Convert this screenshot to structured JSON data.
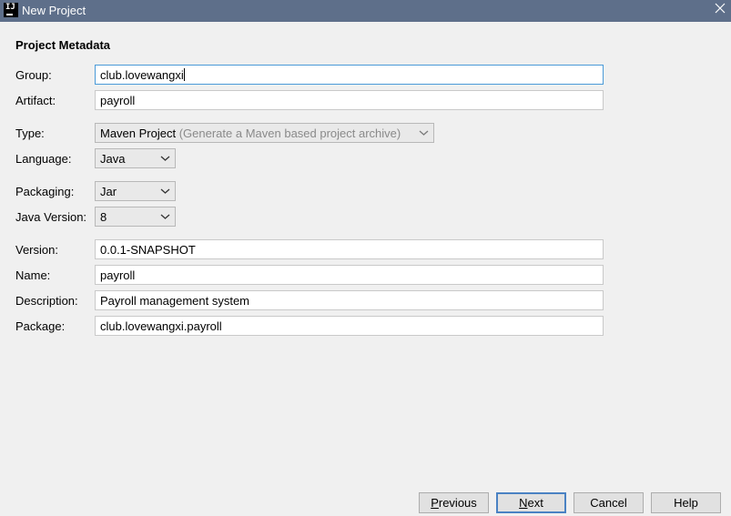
{
  "window": {
    "title": "New Project",
    "app_icon": "intellij-icon",
    "close_icon": "close-icon"
  },
  "form": {
    "section_title": "Project Metadata",
    "group": {
      "label": "Group:",
      "value": "club.lovewangxi"
    },
    "artifact": {
      "label": "Artifact:",
      "value": "payroll"
    },
    "type": {
      "label": "Type:",
      "value": "Maven Project",
      "hint": "(Generate a Maven based project archive)"
    },
    "language": {
      "label": "Language:",
      "value": "Java"
    },
    "packaging": {
      "label": "Packaging:",
      "value": "Jar"
    },
    "java_version": {
      "label": "Java Version:",
      "value": "8"
    },
    "version": {
      "label": "Version:",
      "value": "0.0.1-SNAPSHOT"
    },
    "name": {
      "label": "Name:",
      "value": "payroll"
    },
    "description": {
      "label": "Description:",
      "value": "Payroll management system"
    },
    "package": {
      "label": "Package:",
      "value": "club.lovewangxi.payroll"
    }
  },
  "buttons": {
    "previous": {
      "mnemonic": "P",
      "rest": "revious"
    },
    "next": {
      "mnemonic": "N",
      "rest": "ext"
    },
    "cancel": "Cancel",
    "help": "Help"
  }
}
